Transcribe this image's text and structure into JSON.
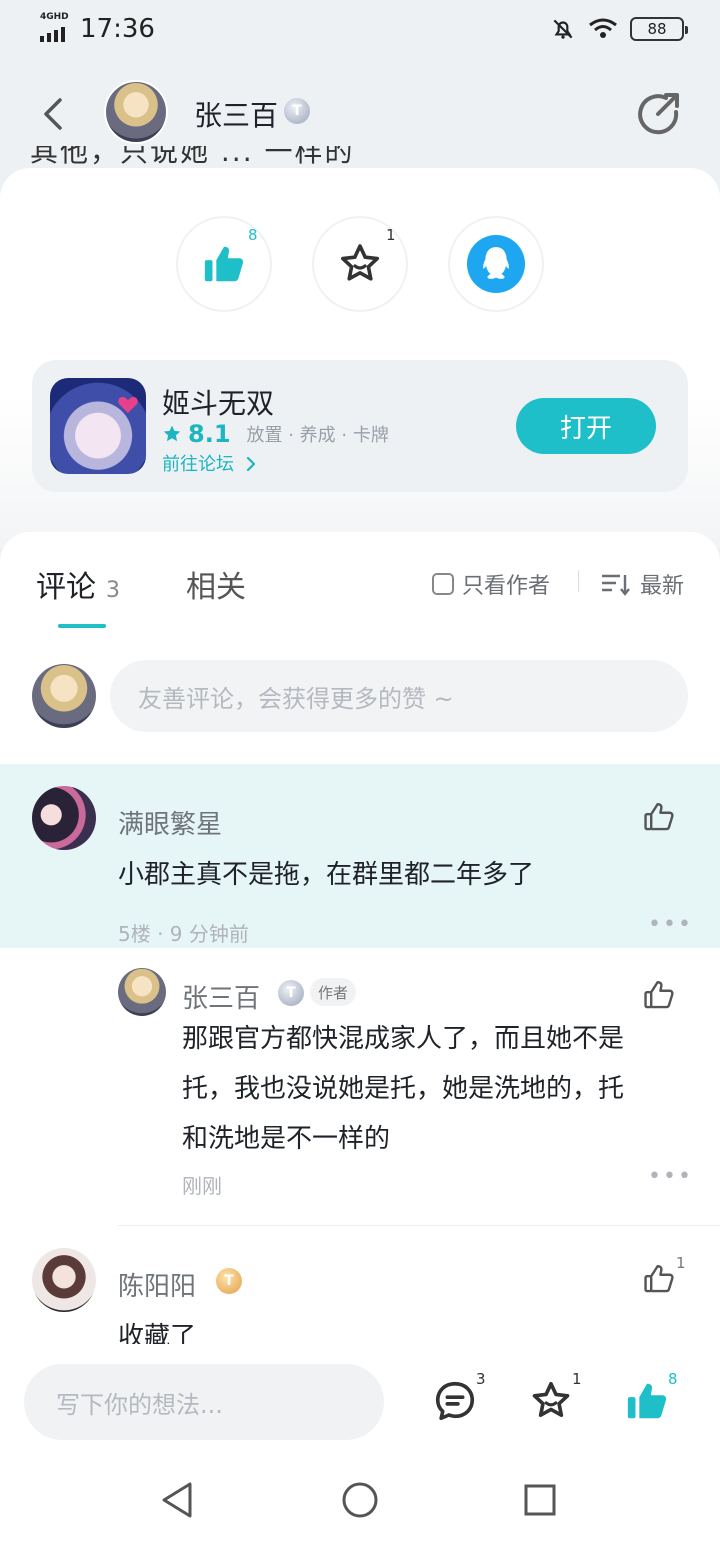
{
  "status_bar": {
    "network": "4GHD",
    "time": "17:36",
    "battery": "88"
  },
  "header": {
    "username": "张三百",
    "level_badge": "T"
  },
  "post_tail": "其他，只说她 ... 一样的",
  "actions": {
    "like_count": "8",
    "favorite_count": "1"
  },
  "game": {
    "title": "姬斗无双",
    "rating": "8.1",
    "tags": "放置 · 养成 · 卡牌",
    "forum_link": "前往论坛",
    "open_label": "打开"
  },
  "tabs": {
    "comments_label": "评论",
    "comments_count": "3",
    "related_label": "相关"
  },
  "filters": {
    "only_author": "只看作者",
    "sort": "最新"
  },
  "comment_box": {
    "placeholder": "友善评论，会获得更多的赞 ~"
  },
  "comments": [
    {
      "name": "满眼繁星",
      "text": "小郡主真不是拖，在群里都二年多了",
      "meta": "5楼 · 9 分钟前"
    },
    {
      "name": "张三百",
      "badge": "T",
      "author_tag": "作者",
      "text_lines": [
        "那跟官方都快混成家人了，而且她不是",
        "托，我也没说她是托，她是洗地的，托",
        "和洗地是不一样的"
      ],
      "meta": "刚刚"
    },
    {
      "name": "陈阳阳",
      "badge": "T",
      "text": "收藏了",
      "like_count": "1"
    }
  ],
  "bottom_bar": {
    "placeholder": "写下你的想法...",
    "comment_count": "3",
    "favorite_count": "1",
    "like_count": "8"
  },
  "colors": {
    "accent": "#1fbfc9",
    "highlight": "#e6f6f7"
  }
}
